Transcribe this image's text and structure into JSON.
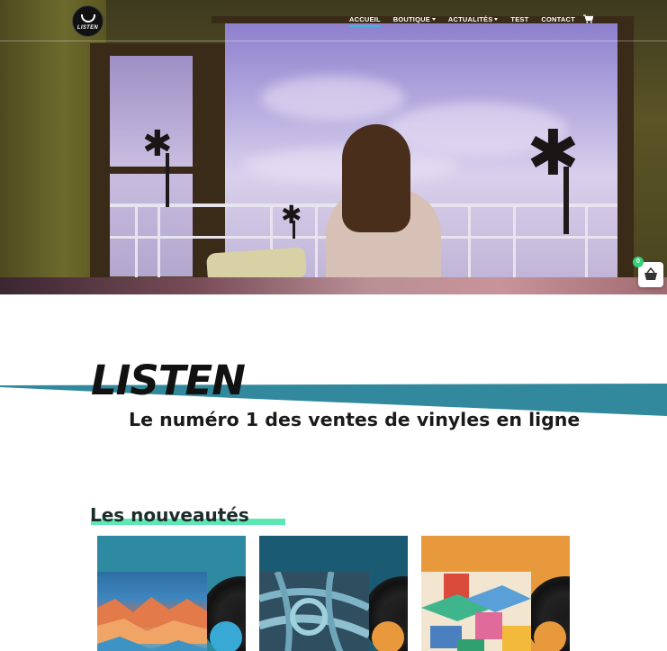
{
  "brand": {
    "logo_text": "LISTEN"
  },
  "nav": {
    "items": [
      {
        "label": "ACCUEIL",
        "active": true,
        "dropdown": false
      },
      {
        "label": "BOUTIQUE",
        "active": false,
        "dropdown": true
      },
      {
        "label": "ACTUALITÉS",
        "active": false,
        "dropdown": true
      },
      {
        "label": "TEST",
        "active": false,
        "dropdown": false
      },
      {
        "label": "CONTACT",
        "active": false,
        "dropdown": false
      }
    ],
    "cart_icon": "shopping-cart-icon"
  },
  "floating_cart": {
    "count": "0",
    "icon": "basket-icon"
  },
  "banner": {
    "title": "LISTEN",
    "tagline": "Le numéro 1 des ventes de vinyles en ligne",
    "accent_color": "#32889c"
  },
  "new_arrivals": {
    "heading": "Les nouveautés",
    "underline_color": "#5de8b3",
    "products": [
      {
        "cover_bg": "#2e8aa0",
        "label_color": "#37a9d4"
      },
      {
        "cover_bg": "#1a5a72",
        "label_color": "#e8993c"
      },
      {
        "cover_bg": "#e8993c",
        "label_color": "#e8993c"
      }
    ]
  }
}
